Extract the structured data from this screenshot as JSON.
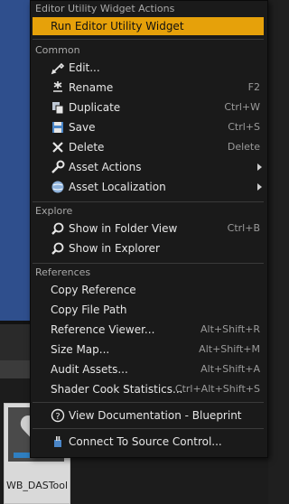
{
  "menu": {
    "header": "Editor Utility Widget Actions",
    "run_item": "Run Editor Utility Widget",
    "sections": {
      "common": "Common",
      "explore": "Explore",
      "references": "References"
    },
    "common_items": [
      {
        "label": "Edit...",
        "shortcut": "",
        "icon": "edit-icon"
      },
      {
        "label": "Rename",
        "shortcut": "F2",
        "icon": "rename-icon"
      },
      {
        "label": "Duplicate",
        "shortcut": "Ctrl+W",
        "icon": "duplicate-icon"
      },
      {
        "label": "Save",
        "shortcut": "Ctrl+S",
        "icon": "save-icon"
      },
      {
        "label": "Delete",
        "shortcut": "Delete",
        "icon": "delete-icon"
      },
      {
        "label": "Asset Actions",
        "shortcut": "",
        "icon": "wrench-icon"
      },
      {
        "label": "Asset Localization",
        "shortcut": "",
        "icon": "globe-icon"
      }
    ],
    "explore_items": [
      {
        "label": "Show in Folder View",
        "shortcut": "Ctrl+B",
        "icon": "magnifier-icon"
      },
      {
        "label": "Show in Explorer",
        "shortcut": "",
        "icon": "magnifier-icon"
      }
    ],
    "reference_items": [
      {
        "label": "Copy Reference",
        "shortcut": ""
      },
      {
        "label": "Copy File Path",
        "shortcut": ""
      },
      {
        "label": "Reference Viewer...",
        "shortcut": "Alt+Shift+R"
      },
      {
        "label": "Size Map...",
        "shortcut": "Alt+Shift+M"
      },
      {
        "label": "Audit Assets...",
        "shortcut": "Alt+Shift+A"
      },
      {
        "label": "Shader Cook Statistics...",
        "shortcut": "Ctrl+Alt+Shift+S"
      }
    ],
    "view_docs": "View Documentation - Blueprint",
    "source_control": "Connect To Source Control..."
  },
  "asset": {
    "name": "WB_DASTools"
  },
  "colors": {
    "highlight": "#e6a10a",
    "menu_bg": "#1a1a1a",
    "viewport_bg": "#2f4f8d"
  }
}
